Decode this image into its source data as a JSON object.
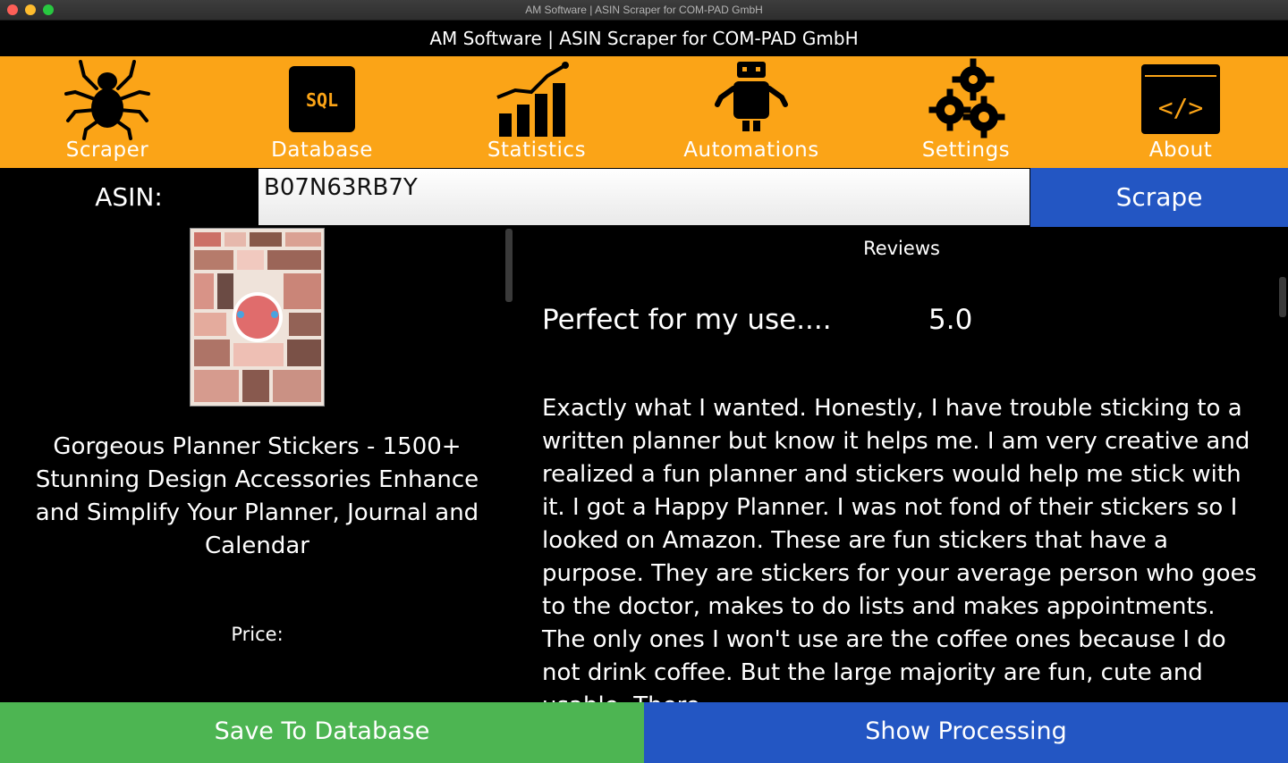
{
  "window": {
    "mac_title": "AM Software | ASIN Scraper for COM-PAD GmbH",
    "header_title": "AM Software | ASIN Scraper for COM-PAD GmbH"
  },
  "toolbar": {
    "background": "#fba417",
    "items": [
      {
        "label": "Scraper",
        "icon": "spider-icon"
      },
      {
        "label": "Database",
        "icon": "sql-database-icon",
        "icon_text": "SQL"
      },
      {
        "label": "Statistics",
        "icon": "bar-chart-icon"
      },
      {
        "label": "Automations",
        "icon": "robot-icon"
      },
      {
        "label": "Settings",
        "icon": "gears-icon"
      },
      {
        "label": "About",
        "icon": "code-window-icon",
        "icon_text": "</>"
      }
    ]
  },
  "asin": {
    "label": "ASIN:",
    "value": "B07N63RB7Y",
    "scrape_label": "Scrape"
  },
  "product": {
    "title": "Gorgeous Planner Stickers - 1500+ Stunning Design Accessories Enhance and Simplify Your Planner, Journal and Calendar",
    "price_label": "Price:"
  },
  "reviews": {
    "heading": "Reviews",
    "items": [
      {
        "title": "Perfect for my use....",
        "rating": "5.0",
        "body": "Exactly what I wanted. Honestly, I have trouble sticking to a written planner but know it helps me. I am very creative and realized a fun planner and stickers would help me stick with it. I got a Happy Planner. I was not fond of their stickers so I looked on Amazon. These are fun stickers that have a purpose. They are stickers for your average person who goes to the doctor, makes to do lists and makes appointments. The only ones I won't use are the coffee ones because I do not drink coffee. But the large majority are fun, cute and usable. There"
      }
    ]
  },
  "footer": {
    "save_label": "Save To Database",
    "process_label": "Show Processing"
  },
  "colors": {
    "green": "#4db552",
    "blue": "#2356c3",
    "orange": "#fba417"
  }
}
